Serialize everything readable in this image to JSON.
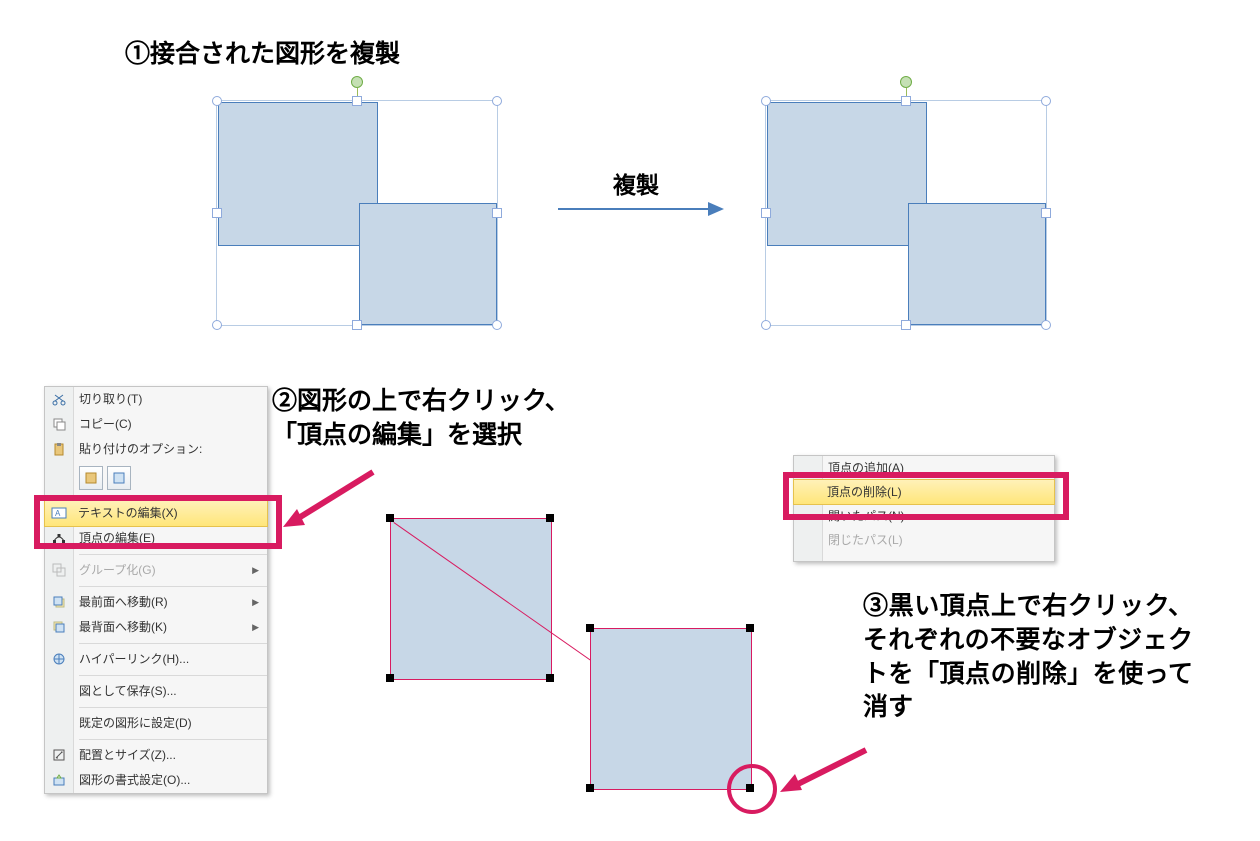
{
  "step1": {
    "heading": "①接合された図形を複製",
    "dup_label": "複製"
  },
  "step2": {
    "line1": "②図形の上で右クリック、",
    "line2": "「頂点の編集」を選択"
  },
  "step3": {
    "heading": "③黒い頂点上で右クリック、それぞれの不要なオブジェクトを「頂点の削除」を使って消す"
  },
  "menu1": {
    "cut": "切り取り(T)",
    "copy": "コピー(C)",
    "pasteopts": "貼り付けのオプション:",
    "edit_text": "テキストの編集(X)",
    "edit_points": "頂点の編集(E)",
    "group": "グループ化(G)",
    "bring_front": "最前面へ移動(R)",
    "send_back": "最背面へ移動(K)",
    "hyperlink": "ハイパーリンク(H)...",
    "save_pic": "図として保存(S)...",
    "set_default": "既定の図形に設定(D)",
    "size_pos": "配置とサイズ(Z)...",
    "format_shape": "図形の書式設定(O)..."
  },
  "menu2": {
    "add_point": "頂点の追加(A)",
    "delete_point": "頂点の削除(L)",
    "open_path": "開いたパス(N)",
    "close_path": "閉じたパス(L)"
  }
}
